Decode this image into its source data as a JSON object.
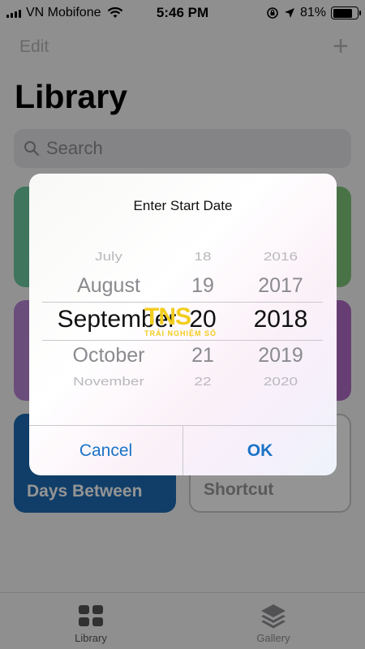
{
  "status_bar": {
    "carrier": "VN Mobifone",
    "time": "5:46 PM",
    "battery": "81%",
    "battery_level": 0.81
  },
  "nav": {
    "edit_label": "Edit",
    "add_label": "+"
  },
  "title": "Library",
  "search": {
    "placeholder": "Search"
  },
  "tiles": {
    "days_between": "Days Between",
    "shortcut": "Shortcut"
  },
  "tab_bar": {
    "library": "Library",
    "gallery": "Gallery"
  },
  "alert": {
    "title": "Enter Start Date",
    "picker": {
      "months": [
        "July",
        "August",
        "September",
        "October",
        "November"
      ],
      "days": [
        "18",
        "19",
        "20",
        "21",
        "22"
      ],
      "years": [
        "2016",
        "2017",
        "2018",
        "2019",
        "2020"
      ]
    },
    "cancel_label": "Cancel",
    "ok_label": "OK"
  },
  "watermark": {
    "logo": "TNS",
    "sub": "TRẢI NGHIỆM SỐ"
  },
  "colors": {
    "accent": "#1a73c7",
    "tile_blue": "#1d6bb3",
    "tile_green": "#6dcaa1",
    "tile_purple": "#b985d6",
    "watermark": "#f2cd1d"
  }
}
